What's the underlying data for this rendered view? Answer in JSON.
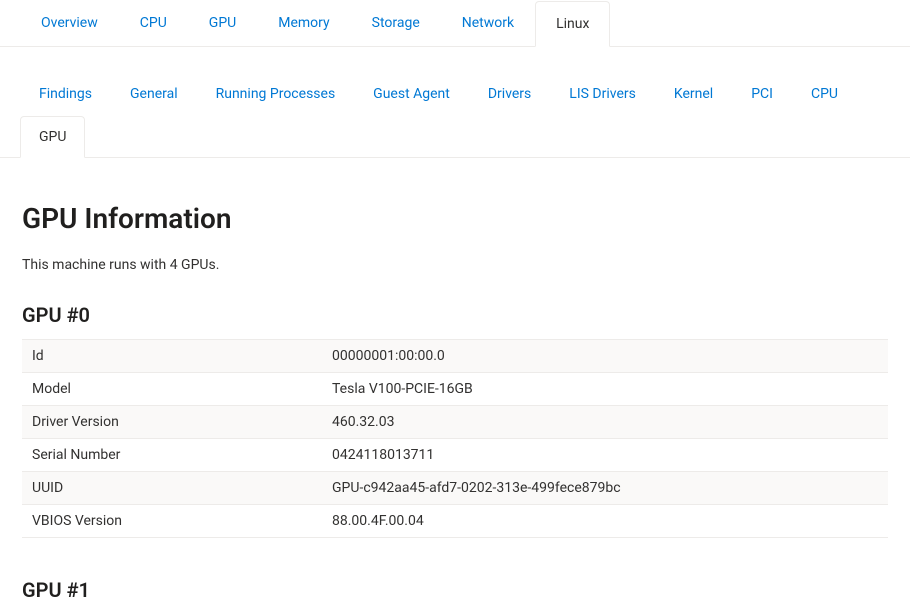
{
  "primaryTabs": {
    "items": [
      {
        "label": "Overview"
      },
      {
        "label": "CPU"
      },
      {
        "label": "GPU"
      },
      {
        "label": "Memory"
      },
      {
        "label": "Storage"
      },
      {
        "label": "Network"
      },
      {
        "label": "Linux"
      }
    ],
    "activeIndex": 6
  },
  "secondaryTabs": {
    "items": [
      {
        "label": "Findings"
      },
      {
        "label": "General"
      },
      {
        "label": "Running Processes"
      },
      {
        "label": "Guest Agent"
      },
      {
        "label": "Drivers"
      },
      {
        "label": "LIS Drivers"
      },
      {
        "label": "Kernel"
      },
      {
        "label": "PCI"
      },
      {
        "label": "CPU"
      },
      {
        "label": "GPU"
      }
    ],
    "activeIndex": 9
  },
  "page": {
    "title": "GPU Information",
    "summary": "This machine runs with 4 GPUs."
  },
  "gpus": [
    {
      "heading": "GPU #0",
      "rows": [
        {
          "key": "Id",
          "value": "00000001:00:00.0"
        },
        {
          "key": "Model",
          "value": "Tesla V100-PCIE-16GB"
        },
        {
          "key": "Driver Version",
          "value": "460.32.03"
        },
        {
          "key": "Serial Number",
          "value": "0424118013711"
        },
        {
          "key": "UUID",
          "value": "GPU-c942aa45-afd7-0202-313e-499fece879bc"
        },
        {
          "key": "VBIOS Version",
          "value": "88.00.4F.00.04"
        }
      ]
    },
    {
      "heading": "GPU #1",
      "rows": []
    }
  ]
}
